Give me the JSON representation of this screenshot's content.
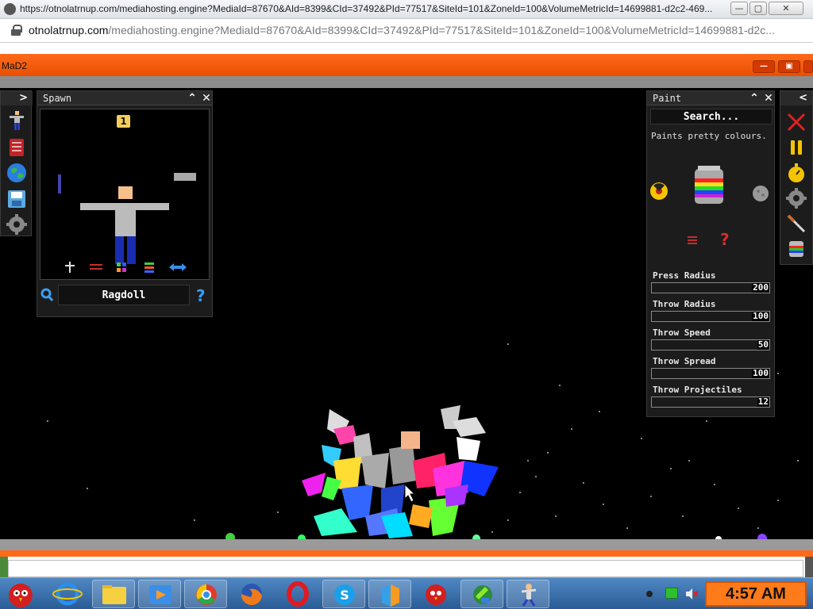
{
  "browser": {
    "title_url": "https://otnolatrnup.com/mediahosting.engine?MediaId=87670&AId=8399&CId=37492&PId=77517&SiteId=101&ZoneId=100&VolumeMetricId=14699881-d2c2-469...",
    "address_domain": "otnolatrnup.com",
    "address_rest": "/mediahosting.engine?MediaId=87670&AId=8399&CId=37492&PId=77517&SiteId=101&ZoneId=100&VolumeMetricId=14699881-d2c...",
    "controls": {
      "minimize": "—",
      "maximize": "▢",
      "close": "✕"
    }
  },
  "game": {
    "window_title": "MaD2",
    "spawn_panel": {
      "title": "Spawn",
      "badge": "1",
      "selected_item": "Ragdoll",
      "help": "?"
    },
    "paint_panel": {
      "title": "Paint",
      "search_placeholder": "Search...",
      "description": "Paints pretty colours.",
      "help": "?",
      "sliders": [
        {
          "label": "Press Radius",
          "value": "200"
        },
        {
          "label": "Throw Radius",
          "value": "100"
        },
        {
          "label": "Throw Speed",
          "value": "50"
        },
        {
          "label": "Throw Spread",
          "value": "100"
        },
        {
          "label": "Throw Projectiles",
          "value": "12"
        }
      ]
    },
    "left_tools": [
      "ragdoll-icon",
      "book-icon",
      "globe-icon",
      "save-icon",
      "gear-icon"
    ],
    "right_tools": [
      "close-x-icon",
      "pause-icon",
      "stopwatch-icon",
      "gear-icon",
      "knife-icon",
      "paint-bucket-icon"
    ]
  },
  "taskbar": {
    "apps": [
      "angry-birds-start",
      "internet-explorer",
      "file-explorer",
      "media-player",
      "chrome",
      "firefox",
      "opera",
      "skype",
      "cube-app",
      "angry-birds",
      "network-app",
      "game-app"
    ],
    "clock": "4:57 AM"
  }
}
